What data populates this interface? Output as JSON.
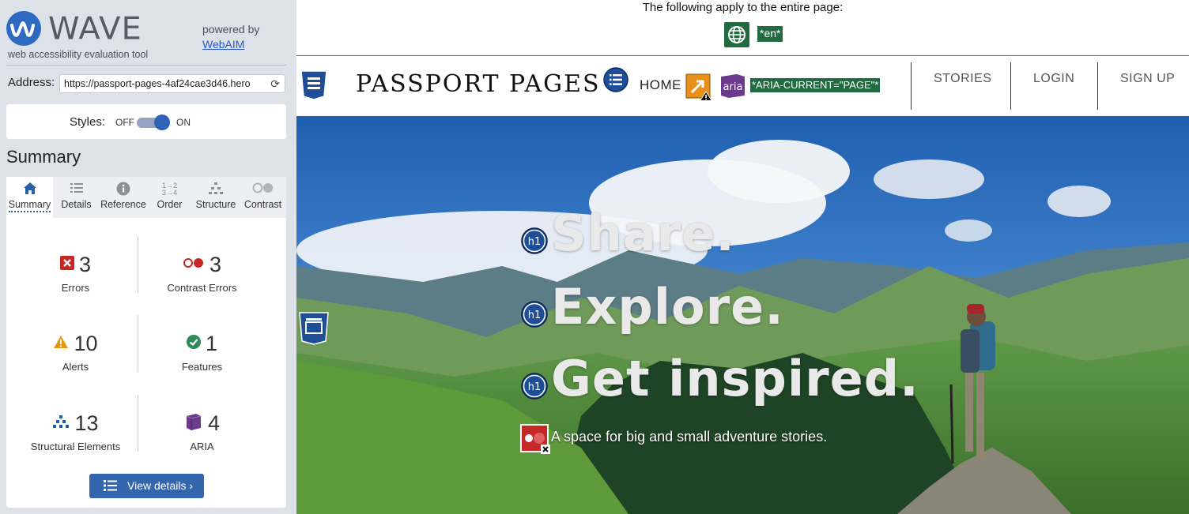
{
  "sidebar": {
    "logo_text": "WAVE",
    "tagline": "web accessibility evaluation tool",
    "powered_by": "powered by",
    "webaim_link": "WebAIM",
    "address_label": "Address:",
    "address_value": "https://passport-pages-4af24cae3d46.hero",
    "styles_label": "Styles:",
    "styles_off": "OFF",
    "styles_on": "ON",
    "summary_heading": "Summary",
    "tabs": [
      {
        "label": "Summary",
        "icon": "home-icon",
        "active": true
      },
      {
        "label": "Details",
        "icon": "list-icon"
      },
      {
        "label": "Reference",
        "icon": "info-icon"
      },
      {
        "label": "Order",
        "icon": "order-icon"
      },
      {
        "label": "Structure",
        "icon": "structure-icon"
      },
      {
        "label": "Contrast",
        "icon": "contrast-icon"
      }
    ],
    "stats": {
      "errors": {
        "count": "3",
        "label": "Errors"
      },
      "contrast_errors": {
        "count": "3",
        "label": "Contrast Errors"
      },
      "alerts": {
        "count": "10",
        "label": "Alerts"
      },
      "features": {
        "count": "1",
        "label": "Features"
      },
      "structural": {
        "count": "13",
        "label": "Structural Elements"
      },
      "aria": {
        "count": "4",
        "label": "ARIA"
      }
    },
    "view_details": "View details ›"
  },
  "page": {
    "apply_text": "The following apply to the entire page:",
    "lang_tag": "*en*",
    "brand": "PASSPORT PAGES",
    "nav_home": "HOME",
    "aria_badge": "aria",
    "aria_current": "*ARIA-CURRENT=\"PAGE\"*",
    "nav_links": [
      "STORIES",
      "LOGIN",
      "SIGN UP"
    ],
    "h1_badge": "h1",
    "hero_lines": [
      "Share.",
      "Explore.",
      "Get inspired."
    ],
    "hero_sub": "A space for big and small adventure stories."
  },
  "colors": {
    "wave_blue": "#2f6ac2",
    "error_red": "#c62828",
    "alert_orange": "#e89612",
    "feature_green": "#2e8b57",
    "structure_blue": "#1e5eb0",
    "aria_purple": "#6b3a8c",
    "wave_tag_green": "#226a3f"
  }
}
